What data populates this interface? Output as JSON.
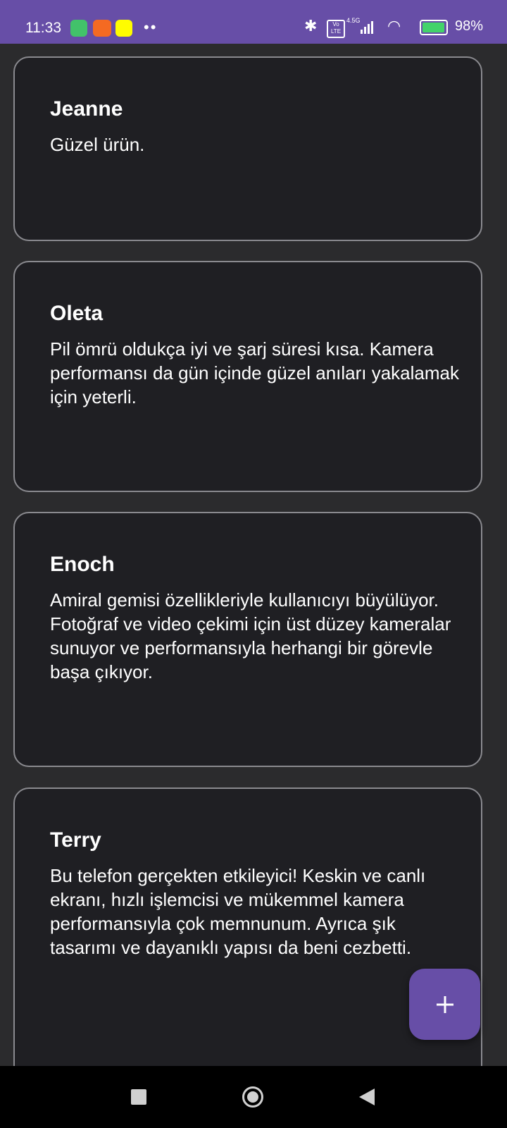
{
  "status_bar": {
    "time": "11:33",
    "network": "4.5G",
    "volte": "Vo LTE",
    "battery_percent": "98%",
    "battery_level": 0.98,
    "overflow": "••",
    "bluetooth_symbol": "✱",
    "wifi_symbol": "◠"
  },
  "reviews": [
    {
      "name": "Jeanne",
      "text": "Güzel ürün."
    },
    {
      "name": "Oleta",
      "text": "Pil ömrü oldukça iyi ve şarj süresi kısa. Kamera performansı da gün içinde güzel anıları yakalamak için yeterli."
    },
    {
      "name": "Enoch",
      "text": "Amiral gemisi özellikleriyle kullanıcıyı büyülüyor. Fotoğraf ve video çekimi için üst düzey kameralar sunuyor ve performansıyla herhangi bir görevle başa çıkıyor."
    },
    {
      "name": "Terry",
      "text": "Bu telefon gerçekten etkileyici! Keskin ve canlı ekranı, hızlı işlemcisi ve mükemmel kamera performansıyla çok memnunum. Ayrıca şık tasarımı ve dayanıklı yapısı da beni cezbetti."
    }
  ],
  "fab": {
    "icon": "plus-icon"
  },
  "colors": {
    "accent": "#674ea7",
    "background": "#2b2b2d",
    "card": "#1f1f23",
    "card_border": "#8a8a8f"
  },
  "icons": {
    "app1": "phone-app-icon",
    "app2": "news-app-icon",
    "app3": "snapchat-icon",
    "nav": [
      "recents-icon",
      "home-icon",
      "back-icon"
    ]
  }
}
